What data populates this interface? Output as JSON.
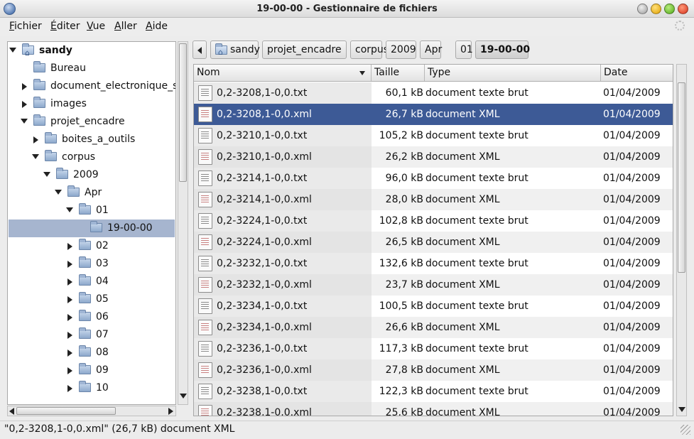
{
  "window": {
    "title": "19-00-00 - Gestionnaire de fichiers"
  },
  "menu": [
    {
      "label": "Fichier",
      "mn": "F",
      "rest": "ichier"
    },
    {
      "label": "Éditer",
      "mn": "É",
      "rest": "diter"
    },
    {
      "label": "Vue",
      "mn": "V",
      "rest": "ue"
    },
    {
      "label": "Aller",
      "mn": "A",
      "rest": "ller"
    },
    {
      "label": "Aide",
      "mn": "A",
      "rest": "ide"
    }
  ],
  "tree": [
    {
      "label": "sandy",
      "bold": true,
      "home": true,
      "expanded": true
    },
    {
      "label": "Bureau"
    },
    {
      "label": "document_electronique_str"
    },
    {
      "label": "images"
    },
    {
      "label": "projet_encadre"
    },
    {
      "label": "boites_a_outils"
    },
    {
      "label": "corpus"
    },
    {
      "label": "2009"
    },
    {
      "label": "Apr"
    },
    {
      "label": "01"
    },
    {
      "label": "19-00-00",
      "selected": true
    },
    {
      "label": "02"
    },
    {
      "label": "03"
    },
    {
      "label": "04"
    },
    {
      "label": "05"
    },
    {
      "label": "06"
    },
    {
      "label": "07"
    },
    {
      "label": "08"
    },
    {
      "label": "09"
    },
    {
      "label": "10"
    }
  ],
  "pathbar": [
    "sandy",
    "projet_encadre",
    "corpus",
    "2009",
    "Apr",
    "01",
    "19-00-00"
  ],
  "columns": {
    "name": "Nom",
    "size": "Taille",
    "type": "Type",
    "date": "Date"
  },
  "files": [
    {
      "name": "0,2-3208,1-0,0.txt",
      "size": "60,1 kB",
      "type": "document texte brut",
      "date": "01/04/2009"
    },
    {
      "name": "0,2-3208,1-0,0.xml",
      "size": "26,7 kB",
      "type": "document XML",
      "date": "01/04/2009",
      "selected": true
    },
    {
      "name": "0,2-3210,1-0,0.txt",
      "size": "105,2 kB",
      "type": "document texte brut",
      "date": "01/04/2009"
    },
    {
      "name": "0,2-3210,1-0,0.xml",
      "size": "26,2 kB",
      "type": "document XML",
      "date": "01/04/2009"
    },
    {
      "name": "0,2-3214,1-0,0.txt",
      "size": "96,0 kB",
      "type": "document texte brut",
      "date": "01/04/2009"
    },
    {
      "name": "0,2-3214,1-0,0.xml",
      "size": "28,0 kB",
      "type": "document XML",
      "date": "01/04/2009"
    },
    {
      "name": "0,2-3224,1-0,0.txt",
      "size": "102,8 kB",
      "type": "document texte brut",
      "date": "01/04/2009"
    },
    {
      "name": "0,2-3224,1-0,0.xml",
      "size": "26,5 kB",
      "type": "document XML",
      "date": "01/04/2009"
    },
    {
      "name": "0,2-3232,1-0,0.txt",
      "size": "132,6 kB",
      "type": "document texte brut",
      "date": "01/04/2009"
    },
    {
      "name": "0,2-3232,1-0,0.xml",
      "size": "23,7 kB",
      "type": "document XML",
      "date": "01/04/2009"
    },
    {
      "name": "0,2-3234,1-0,0.txt",
      "size": "100,5 kB",
      "type": "document texte brut",
      "date": "01/04/2009"
    },
    {
      "name": "0,2-3234,1-0,0.xml",
      "size": "26,6 kB",
      "type": "document XML",
      "date": "01/04/2009"
    },
    {
      "name": "0,2-3236,1-0,0.txt",
      "size": "117,3 kB",
      "type": "document texte brut",
      "date": "01/04/2009"
    },
    {
      "name": "0,2-3236,1-0,0.xml",
      "size": "27,8 kB",
      "type": "document XML",
      "date": "01/04/2009"
    },
    {
      "name": "0,2-3238,1-0,0.txt",
      "size": "122,3 kB",
      "type": "document texte brut",
      "date": "01/04/2009"
    },
    {
      "name": "0,2-3238,1-0,0.xml",
      "size": "25,6 kB",
      "type": "document XML",
      "date": "01/04/2009"
    }
  ],
  "status": "\"0,2-3208,1-0,0.xml\" (26,7 kB) document XML"
}
